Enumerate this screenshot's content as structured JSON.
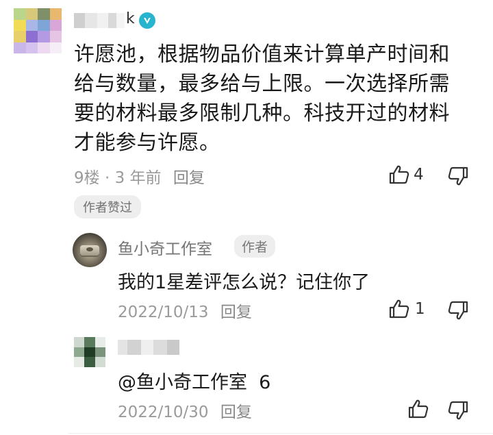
{
  "main_comment": {
    "author_name_visible": "k",
    "text": "许愿池，根据物品价值来计算单产时间和给与数量，最多给与上限。一次选择所需要的材料最多限制几种。科技开过的材料才能参与许愿。",
    "floor": "9楼",
    "separator": "·",
    "time_ago": "3 年前",
    "reply_label": "回复",
    "like_count": "4",
    "author_liked_tag": "作者赞过"
  },
  "reply_1": {
    "author_name": "鱼小奇工作室",
    "author_badge": "作者",
    "text": "我的1星差评怎么说？记住你了",
    "date": "2022/10/13",
    "reply_label": "回复",
    "like_count": "1"
  },
  "reply_2": {
    "text": "@鱼小奇工作室  6",
    "date": "2022/10/30",
    "reply_label": "回复"
  },
  "colors": {
    "verified_badge": "#27b4cf",
    "meta_text": "#9a9a9a",
    "tag_bg": "#eeeeee"
  }
}
